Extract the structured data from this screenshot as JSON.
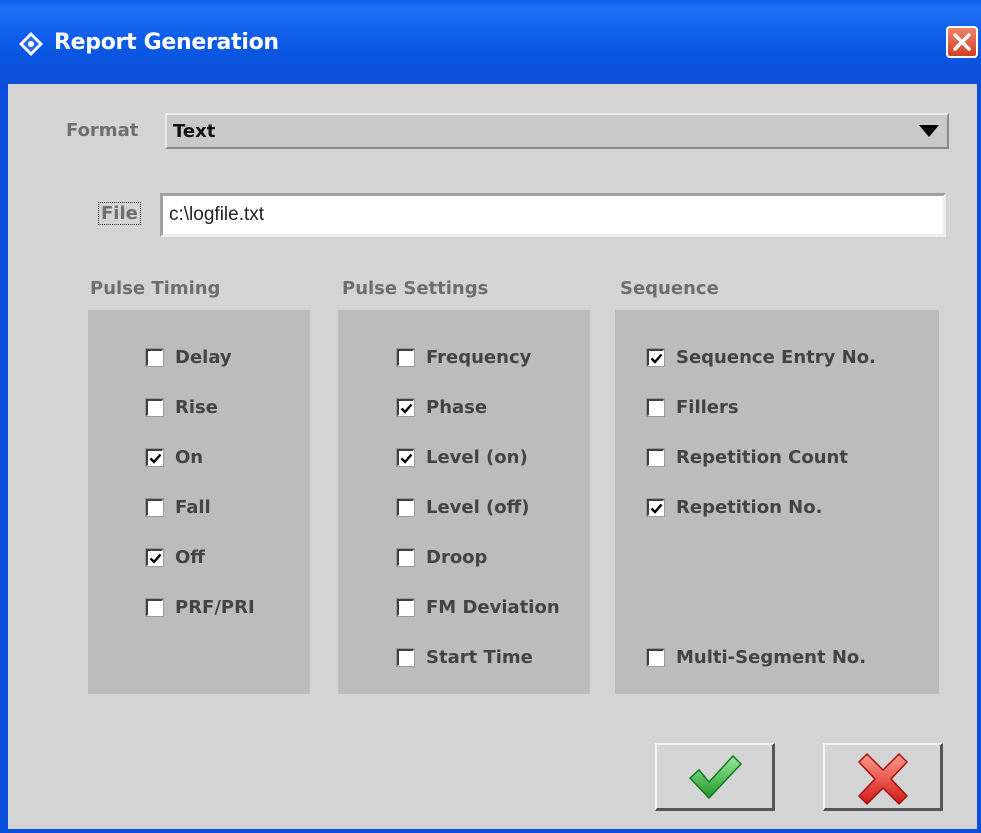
{
  "window": {
    "title": "Report Generation"
  },
  "format": {
    "label": "Format",
    "value": "Text"
  },
  "file": {
    "label": "File",
    "value": "c:\\logfile.txt"
  },
  "groups": {
    "pulse_timing": {
      "title": "Pulse Timing",
      "items": [
        {
          "label": "Delay",
          "checked": false
        },
        {
          "label": "Rise",
          "checked": false
        },
        {
          "label": "On",
          "checked": true
        },
        {
          "label": "Fall",
          "checked": false
        },
        {
          "label": "Off",
          "checked": true
        },
        {
          "label": "PRF/PRI",
          "checked": false
        }
      ]
    },
    "pulse_settings": {
      "title": "Pulse Settings",
      "items": [
        {
          "label": "Frequency",
          "checked": false
        },
        {
          "label": "Phase",
          "checked": true
        },
        {
          "label": "Level (on)",
          "checked": true
        },
        {
          "label": "Level (off)",
          "checked": false
        },
        {
          "label": "Droop",
          "checked": false
        },
        {
          "label": "FM Deviation",
          "checked": false
        },
        {
          "label": "Start Time",
          "checked": false
        }
      ]
    },
    "sequence": {
      "title": "Sequence",
      "items": [
        {
          "label": "Sequence Entry No.",
          "checked": true
        },
        {
          "label": "Fillers",
          "checked": false
        },
        {
          "label": "Repetition Count",
          "checked": false
        },
        {
          "label": "Repetition No.",
          "checked": true
        },
        {
          "label": "Multi-Segment No.",
          "checked": false
        }
      ]
    }
  },
  "buttons": {
    "ok_icon": "checkmark-icon",
    "cancel_icon": "cross-icon"
  },
  "colors": {
    "titlebar": "#0a58e6",
    "panel": "#bcbcbc",
    "window": "#d4d4d4",
    "ok": "#3cb43c",
    "cancel": "#e02020"
  }
}
